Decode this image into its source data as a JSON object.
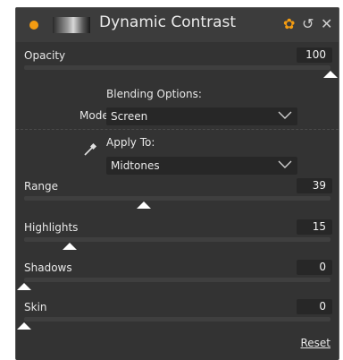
{
  "header": {
    "title": "Dynamic Contrast",
    "gear_icon": "gear-icon",
    "undo_icon": "undo-icon",
    "close_icon": "close-icon"
  },
  "opacity": {
    "label": "Opacity",
    "value": "100",
    "level": 1.0
  },
  "blending": {
    "label": "Blending Options:",
    "mode_label": "Mode",
    "mode_value": "Screen"
  },
  "apply": {
    "label": "Apply To:",
    "value": "Midtones",
    "icon": "eyedropper-icon"
  },
  "range": {
    "label": "Range",
    "value": "39",
    "level": 0.39
  },
  "highlights": {
    "label": "Highlights",
    "value": "15",
    "level": 0.15
  },
  "shadows": {
    "label": "Shadows",
    "value": "0",
    "level": 0
  },
  "skin": {
    "label": "Skin",
    "value": "0",
    "level": 0
  },
  "footer": {
    "reset_label": "Reset"
  },
  "colors": {
    "accent": "#f39c12",
    "panel": "#333333"
  }
}
